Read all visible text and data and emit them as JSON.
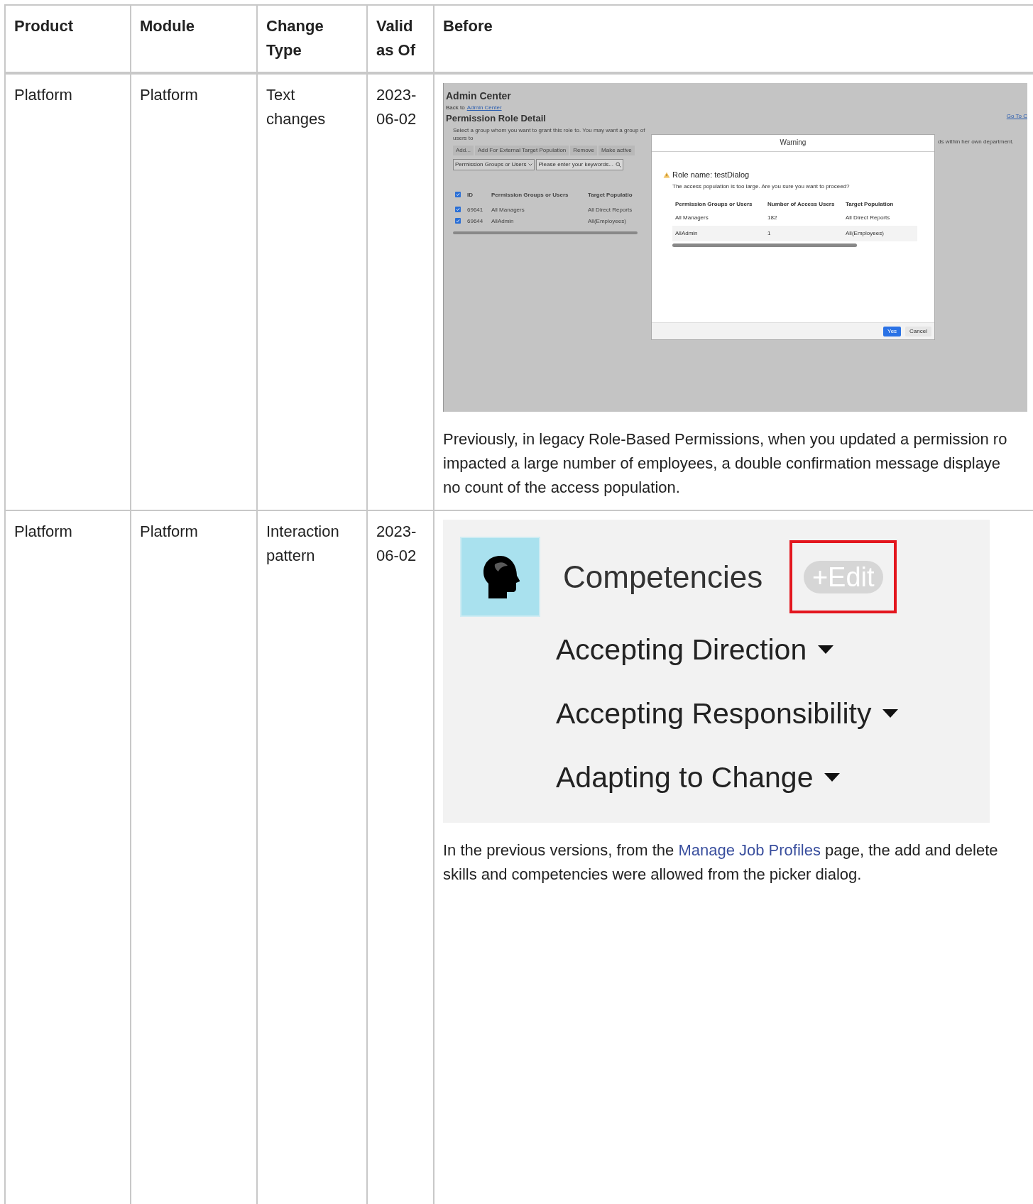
{
  "table": {
    "columns": [
      "Product",
      "Module",
      "Change Type",
      "Valid as Of",
      "Before"
    ],
    "rows": [
      {
        "cells": [
          "Platform",
          "Platform",
          "Text changes",
          "2023-06-02"
        ],
        "before": {
          "screenshot": {
            "kind": "admin_dialog",
            "page_title": "Admin Center",
            "back_prefix": "Back to",
            "back_link": "Admin Center",
            "go_link": "Go To C",
            "section_title": "Permission Role Detail",
            "instruction": "Select a group whom you want to grant this role to. You may want a group of users to",
            "instruction_tail": "ds within her own department.",
            "toolbar": [
              "Add...",
              "Add For External Target Population",
              "Remove",
              "Make active"
            ],
            "filter_select": "Permission Groups or Users",
            "search_placeholder": "Please enter your keywords...",
            "grid_columns": [
              "ID",
              "Permission Groups or Users",
              "Target Populatio"
            ],
            "grid_header_checked": true,
            "grid_rows": [
              {
                "checked": true,
                "cells": [
                  "69641",
                  "All Managers",
                  "All Direct Reports"
                ]
              },
              {
                "checked": true,
                "cells": [
                  "69644",
                  "AllAdmin",
                  "All(Employees)"
                ]
              }
            ],
            "dialog": {
              "title": "Warning",
              "heading": "Role name: testDialog",
              "message": "The access population is too large. Are you sure you want to proceed?",
              "columns": [
                "Permission Groups or Users",
                "Number of Access Users",
                "Target Population"
              ],
              "rows": [
                [
                  "All Managers",
                  "182",
                  "All Direct Reports"
                ],
                [
                  "AllAdmin",
                  "1",
                  "All(Employees)"
                ]
              ],
              "buttons": [
                {
                  "label": "Yes",
                  "primary": true
                },
                {
                  "label": "Cancel",
                  "primary": false
                }
              ]
            }
          },
          "paragraph": [
            [
              {
                "text": "Previously, in legacy Role-Based Permissions, when you updated a permission ro"
              }
            ],
            [
              {
                "text": "impacted a large number of employees, a double confirmation message displaye"
              }
            ],
            [
              {
                "text": "no count of the access population."
              }
            ]
          ]
        }
      },
      {
        "cells": [
          "Platform",
          "Platform",
          "Interaction pattern",
          "2023-06-02"
        ],
        "before": {
          "screenshot": {
            "kind": "competencies",
            "title": "Competencies",
            "edit_button": "+Edit",
            "items": [
              "Accepting Direction",
              "Accepting Responsibility",
              "Adapting to Change"
            ]
          },
          "paragraph": [
            [
              {
                "text": "In the previous versions, from the "
              },
              {
                "text": "Manage Job Profiles",
                "link": true
              },
              {
                "text": " page, the add and delete"
              }
            ],
            [
              {
                "text": "skills and competencies were allowed from the picker dialog."
              }
            ]
          ]
        }
      }
    ]
  }
}
